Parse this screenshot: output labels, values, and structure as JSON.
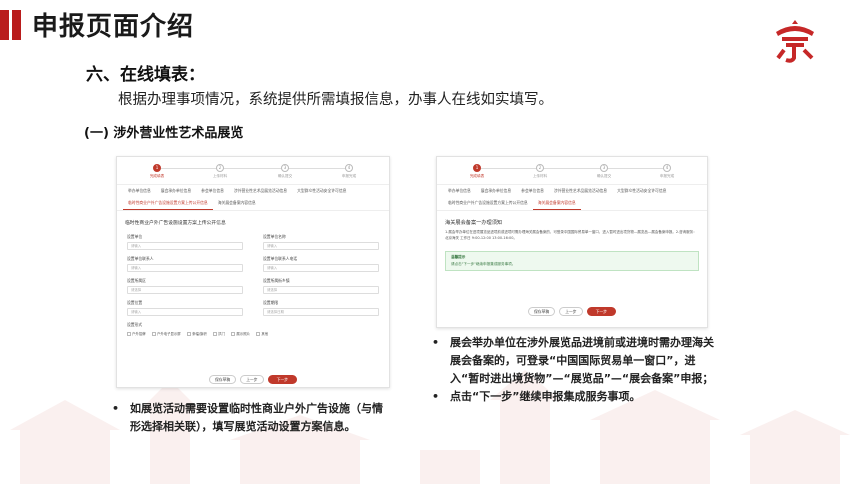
{
  "header": {
    "title": "申报页面介绍"
  },
  "section": {
    "title": "六、在线填表：",
    "description": "根据办理事项情况，系统提供所需填报信息，办事人在线如实填写。",
    "subtitle": "(一) 涉外营业性艺术品展览"
  },
  "screenshot_left": {
    "steps": [
      "完成填表",
      "上传材料",
      "确认提交",
      "申报完成"
    ],
    "tabs": [
      "举办单位信息",
      "展会承办单位信息",
      "参会单位信息",
      "涉外营业性艺术品展览活动信息",
      "大型群众性活动安全许可信息",
      "临时性商业户外广告设施设置方案上传公开信息",
      "海关展会备案内容信息"
    ],
    "form_title": "临时性商业户外广告设施设置方案上传公开信息",
    "fields": [
      {
        "label": "设置单位",
        "placeholder": "请输入"
      },
      {
        "label": "设置单位名称",
        "placeholder": "请输入"
      },
      {
        "label": "设置单位联系人",
        "placeholder": "请输入"
      },
      {
        "label": "设置单位联系人电话",
        "placeholder": "请输入"
      },
      {
        "label": "设置所属区",
        "placeholder": "请选择"
      },
      {
        "label": "设置所属街乡镇",
        "placeholder": "请选择"
      },
      {
        "label": "设置位置",
        "placeholder": "请输入"
      },
      {
        "label": "设置期限",
        "placeholder": "请选择日期"
      }
    ],
    "checks_label": "设置形式",
    "checks": [
      "户外招牌",
      "户外电子显示屏",
      "条幅/旗帜",
      "拱门",
      "展示照片",
      "其他"
    ],
    "buttons": {
      "save": "保存草稿",
      "prev": "上一步",
      "next": "下一步"
    }
  },
  "screenshot_right": {
    "steps": [
      "完成填表",
      "上传材料",
      "确认提交",
      "申报完成"
    ],
    "tabs": [
      "举办单位信息",
      "展会承办单位信息",
      "参会单位信息",
      "涉外营业性艺术品展览活动信息",
      "大型群众性活动安全许可信息",
      "临时性商业户外广告设施设置方案上传公开信息",
      "海关展会备案内容信息"
    ],
    "notice_title": "海关展会备案一办理须知",
    "notice_body": "1.展会举办单位在进境展览品进境前或进境时需办理海关展会备案的，可登录中国国际贸易单一窗口，进入暂时进出境货物—展览品—展会备案申报。2.咨询服务：北京海关 工作日 9:00-12:00 13:00-16:00。",
    "tip_title": "温馨提示",
    "tip_body": "请点击\"下一步\"继续申报集成服务事项。",
    "buttons": {
      "save": "保存草稿",
      "prev": "上一步",
      "next": "下一步"
    }
  },
  "bullets_left": [
    "如展览活动需要设置临时性商业户外广告设施（与情形选择相关联），填写展览活动设置方案信息。"
  ],
  "bullets_right": [
    "展会举办单位在涉外展览品进境前或进境时需办理海关展会备案的，可登录“中国国际贸易单一窗口”，进入“暂时进出境货物”—“展览品”—“展会备案”申报；",
    "点击“下一步”继续申报集成服务事项。"
  ],
  "colors": {
    "accent": "#b91c1c",
    "primary_button": "#c0392b"
  }
}
